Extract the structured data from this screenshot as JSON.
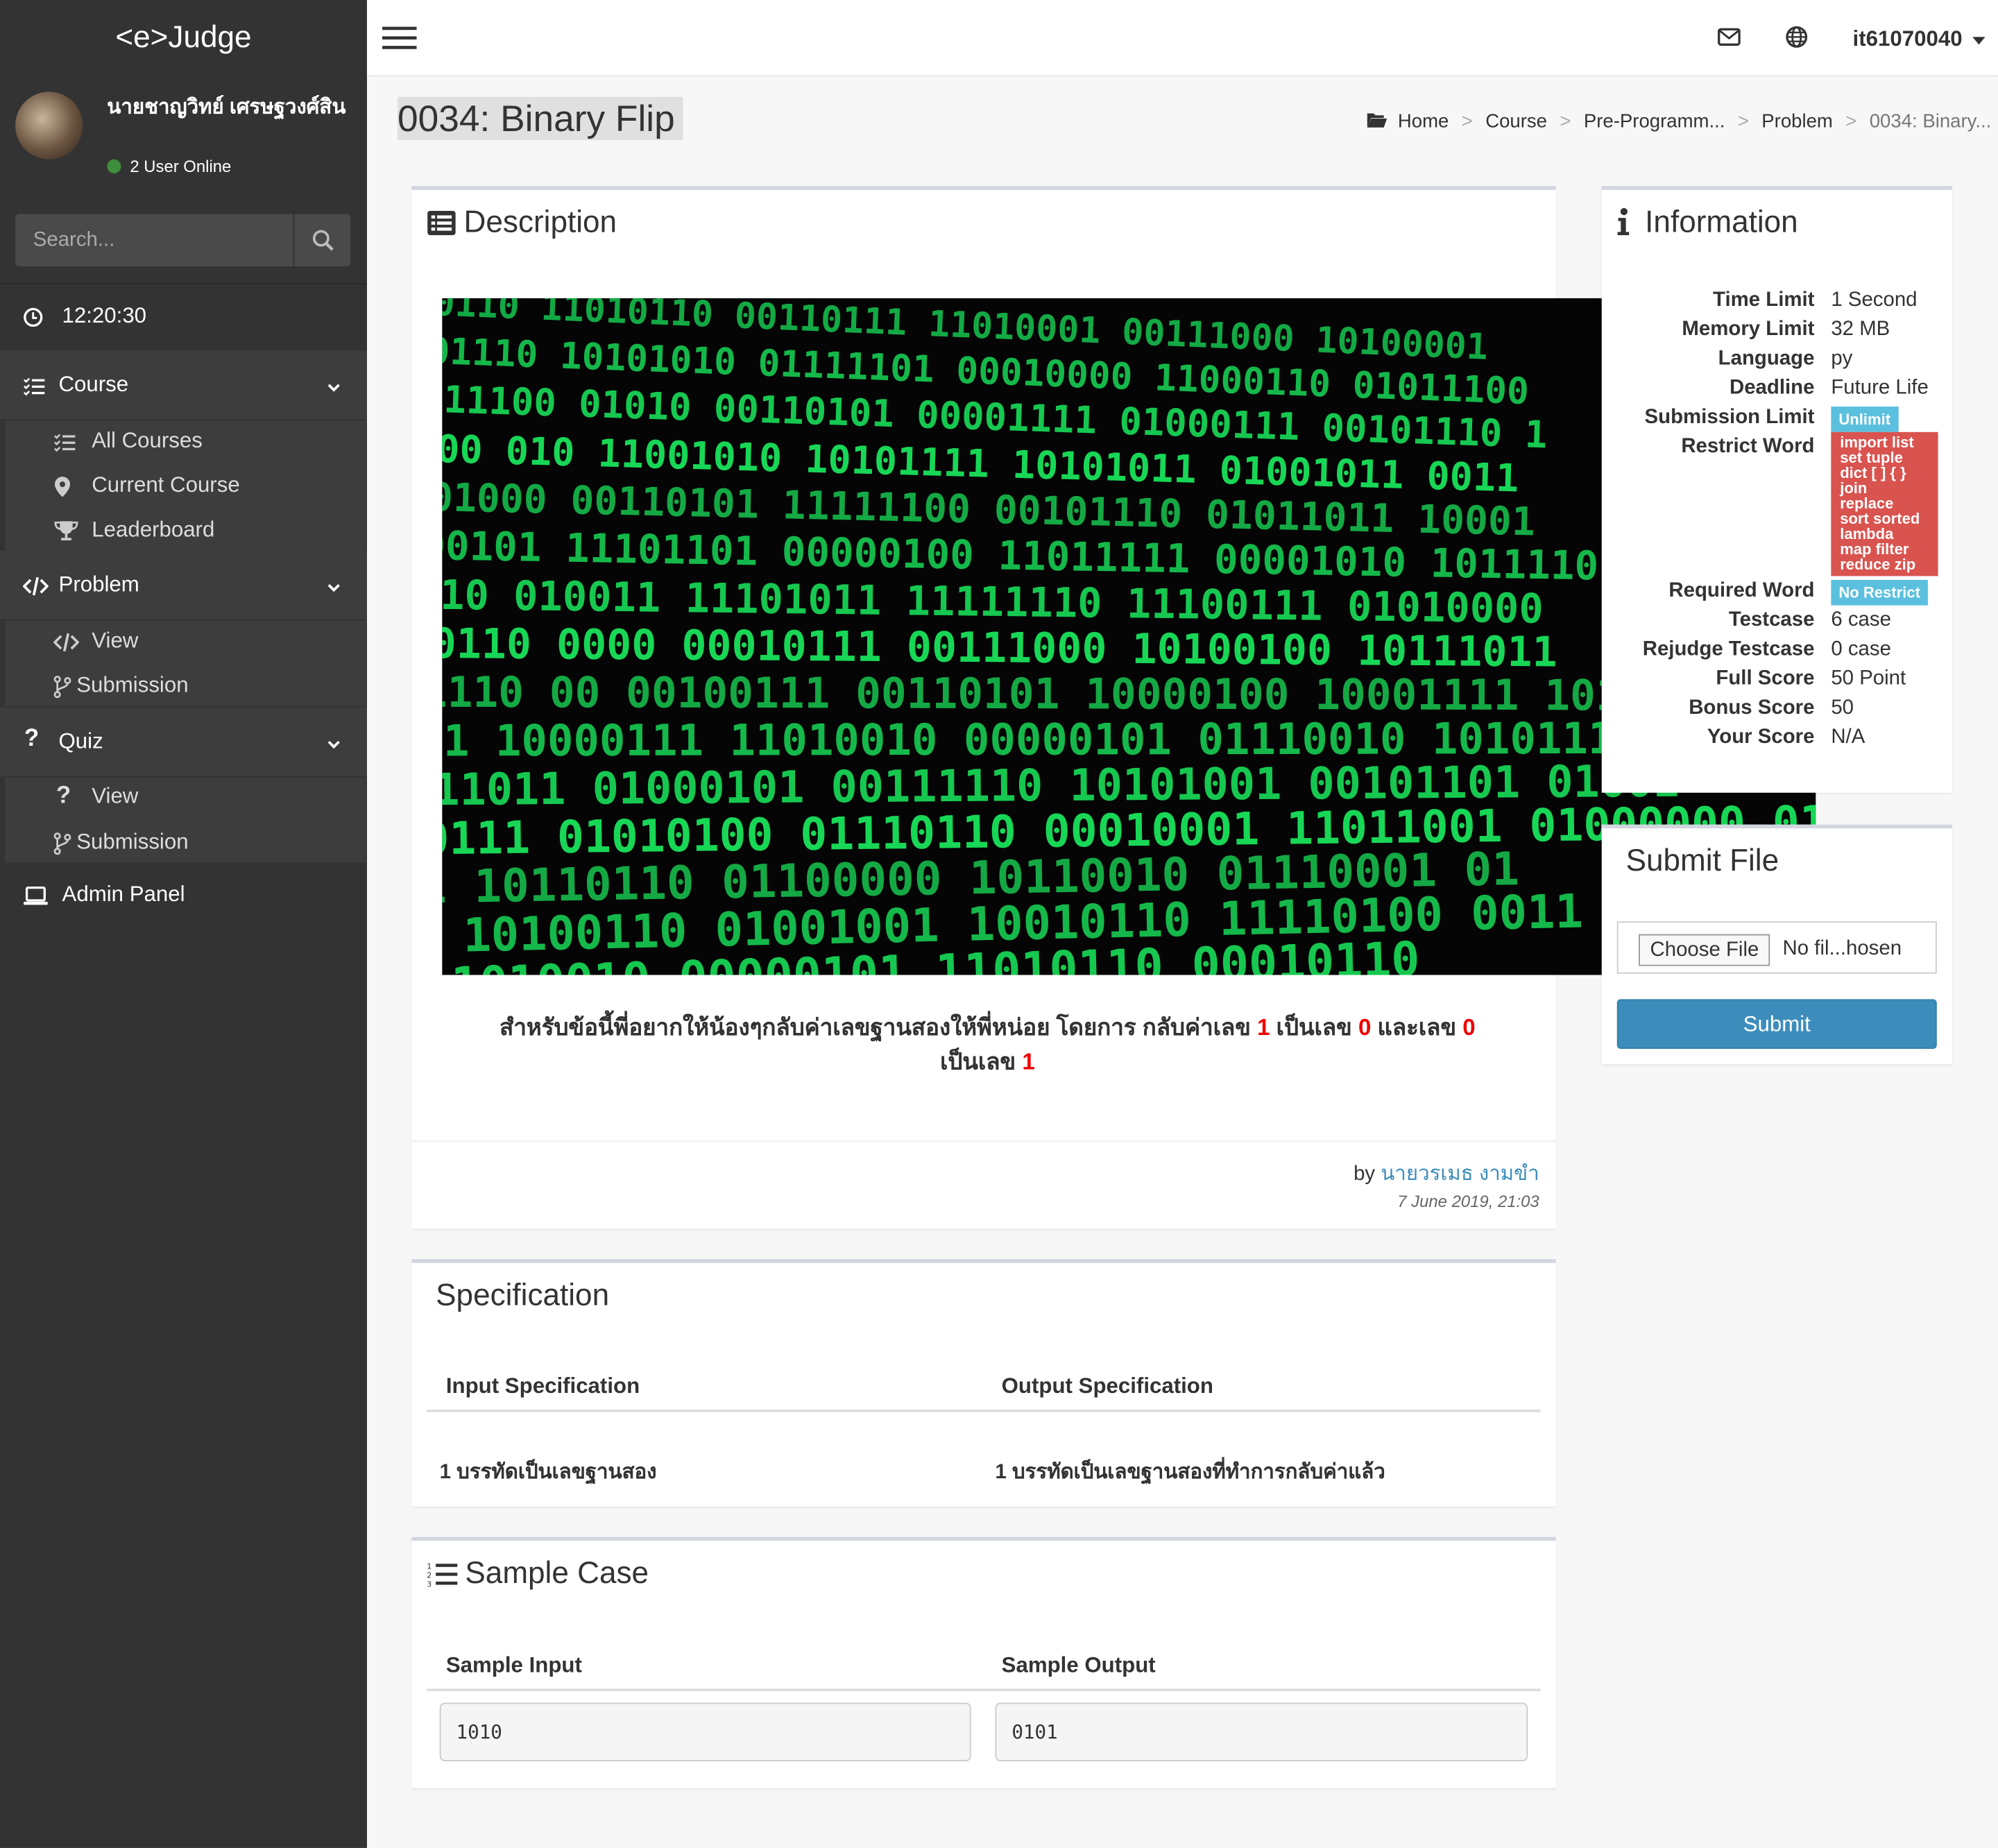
{
  "app": {
    "logo": "<e>Judge"
  },
  "user": {
    "name": "นายชาญวิทย์ เศรษฐวงศ์สิน",
    "online": "2 User Online",
    "id": "it61070040"
  },
  "sidebar": {
    "search_placeholder": "Search...",
    "clock": "12:20:30",
    "groups": [
      {
        "label": "Course",
        "items": [
          "All Courses",
          "Current Course",
          "Leaderboard"
        ]
      },
      {
        "label": "Problem",
        "items": [
          "View",
          "Submission"
        ]
      },
      {
        "label": "Quiz",
        "items": [
          "View",
          "Submission"
        ]
      }
    ],
    "admin": "Admin Panel"
  },
  "page": {
    "title": "0034: Binary Flip",
    "breadcrumb": [
      "Home",
      "Course",
      "Pre-Programm...",
      "Problem",
      "0034: Binary..."
    ]
  },
  "description": {
    "heading": "Description",
    "text_a": "สำหรับข้อนี้พี่อยากให้น้องๆกลับค่าเลขฐานสองให้พี่หน่อย โดยการ กลับค่าเลข",
    "n1": "1",
    "text_b": "เป็นเลข",
    "n2": "0",
    "text_c": "และเลข",
    "n3": "0",
    "text_d": "เป็นเลข",
    "n4": "1",
    "by_label": "by",
    "author": "นายวรเมธ งามขำ",
    "date": "7 June 2019, 21:03",
    "image_rows": [
      "010110  11010110 00110111  11010001  00111000  10100001",
      "101110  10101010  01111101  00010000  11000110  01011100",
      "011100  01010  00110101  00001111  01000111  00101110  1",
      "1000 010  11001010  10101111  10101011  01001011  0011",
      "001000  00110101  11111100  00101110  01011011  10001",
      "00101 11101101  00000100  11011111  00001010  10111101",
      "0110 010011  11101011  11111110  11100111  01010000",
      "00110 0000  00010111  00111000  10100100  10111011",
      "1110 00  00100111  00110101  10000100  10001111  1011",
      "001 10000111  11010010  00000101  01110010  10101111  1",
      "011011  01000101  00111110  10101001  00101101  01001",
      "0111  01010100  01110110  00010001  11011001  01000000 010",
      "11  10110110  01100000  10110010  01110001  01",
      "1  10100110  01001001  10010110  11110100  0011",
      "11010010  00000101  11010110  00010110"
    ]
  },
  "specification": {
    "heading": "Specification",
    "input_header": "Input Specification",
    "output_header": "Output Specification",
    "input_text": "1 บรรทัดเป็นเลขฐานสอง",
    "output_text": "1 บรรทัดเป็นเลขฐานสองที่ทำการกลับค่าแล้ว"
  },
  "sample": {
    "heading": "Sample Case",
    "input_header": "Sample Input",
    "output_header": "Sample Output",
    "input": "1010",
    "output": "0101"
  },
  "information": {
    "heading": "Information",
    "rows": {
      "time_limit": {
        "label": "Time Limit",
        "value": "1 Second"
      },
      "memory_limit": {
        "label": "Memory Limit",
        "value": "32 MB"
      },
      "language": {
        "label": "Language",
        "value": "py"
      },
      "deadline": {
        "label": "Deadline",
        "value": "Future Life"
      },
      "submission_limit": {
        "label": "Submission Limit",
        "value": "Unlimit"
      },
      "restrict_word": {
        "label": "Restrict Word",
        "value": [
          "import list",
          "set tuple",
          "dict [ ] { }",
          "join",
          "replace",
          "sort sorted",
          "lambda",
          "map filter",
          "reduce zip"
        ]
      },
      "required_word": {
        "label": "Required Word",
        "value": "No Restrict"
      },
      "testcase": {
        "label": "Testcase",
        "value": "6 case"
      },
      "rejudge_testcase": {
        "label": "Rejudge Testcase",
        "value": "0 case"
      },
      "full_score": {
        "label": "Full Score",
        "value": "50 Point"
      },
      "bonus_score": {
        "label": "Bonus Score",
        "value": "50"
      },
      "your_score": {
        "label": "Your Score",
        "value": "N/A"
      }
    }
  },
  "submit_file": {
    "heading": "Submit File",
    "choose": "Choose File",
    "no_file": "No fil...hosen",
    "submit": "Submit"
  },
  "colors": {
    "sidebar": "#333333",
    "accent": "#3c8dbc",
    "badge_info": "#5bc0de",
    "badge_danger": "#d9534f",
    "matrix_green": "#19e05a"
  }
}
